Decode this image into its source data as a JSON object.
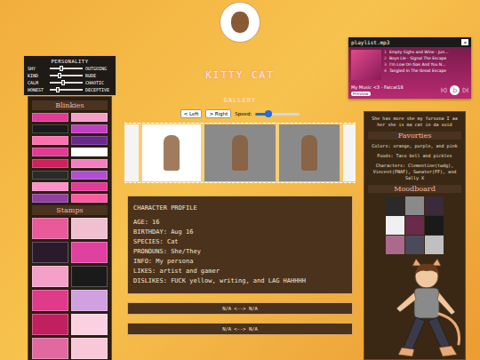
{
  "profile_header": {
    "name": "KITTY CAT"
  },
  "personality": {
    "title": "PERSONALITY",
    "traits": [
      {
        "left": "SHY",
        "right": "OUTGOING",
        "level": 0.35
      },
      {
        "left": "KIND",
        "right": "RUDE",
        "level": 0.3
      },
      {
        "left": "CALM",
        "right": "CHAOTIC",
        "level": 0.4
      },
      {
        "left": "HONEST",
        "right": "DECEPTIVE",
        "level": 0.25
      }
    ]
  },
  "blinkies": {
    "title": "Blinkies"
  },
  "stamps": {
    "title": "Stamps"
  },
  "gallery": {
    "title": "GALLERY",
    "buttons": [
      "< Left",
      "> Right"
    ],
    "speed_label": "Speed:",
    "speed_level": 0.3
  },
  "character_profile": {
    "title": "CHARACTER PROFILE",
    "fields": [
      "AGE: 16",
      "BIRTHDAY: Aug 16",
      "SPECIES: Cat",
      "PRONOUNS: She/They",
      "INFO: My persona",
      "LIKES: artist and gamer",
      "DISLIKES: FUCK yellow, writing, and LAG HAHHHH"
    ]
  },
  "links": [
    "N/A <--> N/A",
    "N/A <--> N/A"
  ],
  "playlist": {
    "title": "playlist.mp3",
    "close": "×",
    "tracks": [
      {
        "number": "1",
        "title": "Empty Sighs and Wine - Jun..."
      },
      {
        "number": "2",
        "title": "Boys Lie - Signal The Escape"
      },
      {
        "number": "3",
        "title": "I'm Low On Gas And You N..."
      },
      {
        "number": "4",
        "title": "Tangled In The Great Escape"
      }
    ],
    "footer": "My Music <3 - Fatcat18",
    "preview": "Preview"
  },
  "about": {
    "bio": "She has more she my fursona I aa her she is ma cat in da void",
    "favorites_title": "Favorties",
    "favorites": [
      "Colors: orange, purple, and pink",
      "Foods: Taco bell and pickles",
      "Characters: Clementine(twdg), Vincent(FNAF), Sweater(FF), and Sally X"
    ],
    "moodboard_title": "Moodboard"
  }
}
